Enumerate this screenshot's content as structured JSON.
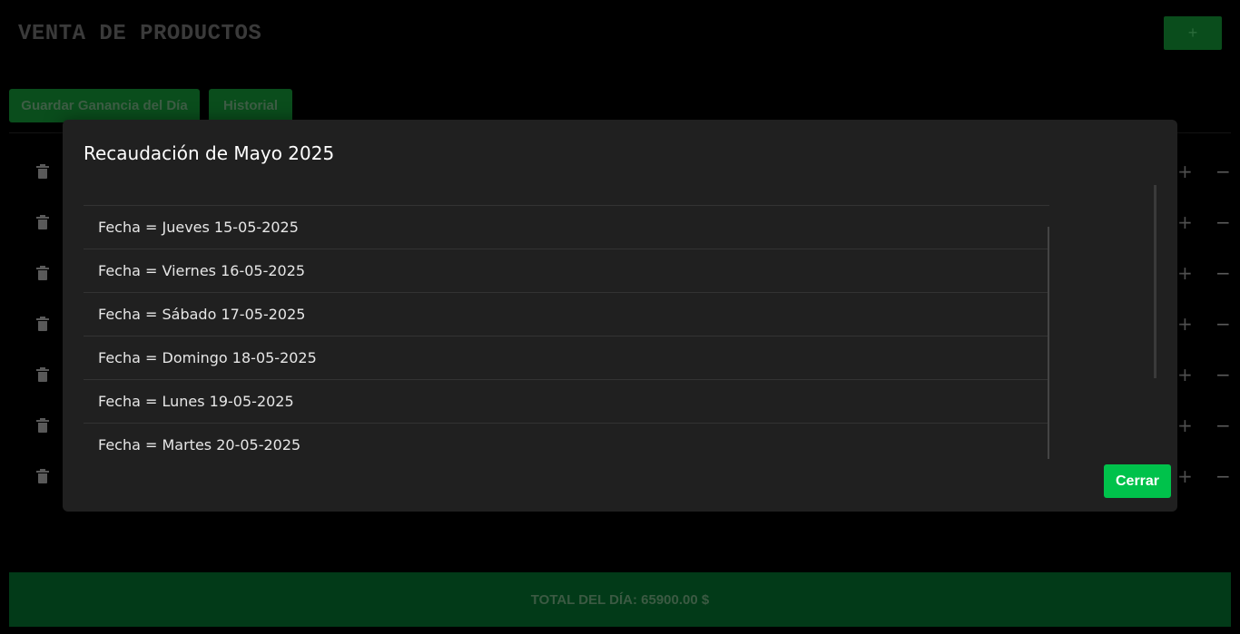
{
  "app": {
    "title": "VENTA DE PRODUCTOS",
    "add_label": "+",
    "save_day_label": "Guardar Ganancia del Día",
    "history_label": "Historial",
    "total_label": "TOTAL DEL DÍA: 65900.00 $"
  },
  "rows": [
    {
      "plus": "+",
      "minus": "−"
    },
    {
      "plus": "+",
      "minus": "−"
    },
    {
      "plus": "+",
      "minus": "−"
    },
    {
      "plus": "+",
      "minus": "−"
    },
    {
      "plus": "+",
      "minus": "−"
    },
    {
      "plus": "+",
      "minus": "−"
    },
    {
      "plus": "+",
      "minus": "−"
    }
  ],
  "modal": {
    "title": "Recaudación de Mayo 2025",
    "items": [
      "Fecha = Jueves 15-05-2025",
      "Fecha = Viernes 16-05-2025",
      "Fecha = Sábado 17-05-2025",
      "Fecha = Domingo 18-05-2025",
      "Fecha = Lunes 19-05-2025",
      "Fecha = Martes 20-05-2025"
    ],
    "close_label": "Cerrar"
  },
  "colors": {
    "accent_green": "#00c24b",
    "dark_green": "#0a4d1c",
    "modal_bg": "#202020"
  },
  "icons": {
    "row_delete": "trash-icon",
    "row_increment": "plus-icon",
    "row_decrement": "minus-icon"
  }
}
